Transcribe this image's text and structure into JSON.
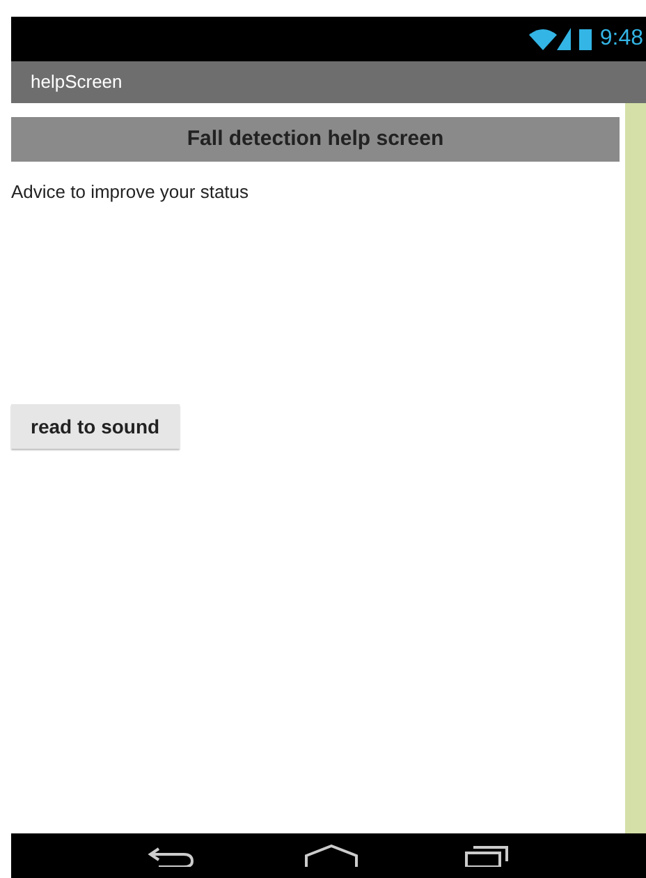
{
  "status_bar": {
    "time": "9:48"
  },
  "title_bar": {
    "title": "helpScreen"
  },
  "header": {
    "text": "Fall detection help screen"
  },
  "advice": {
    "text": "Advice to improve your status"
  },
  "buttons": [
    {
      "label": "read to sound"
    }
  ]
}
